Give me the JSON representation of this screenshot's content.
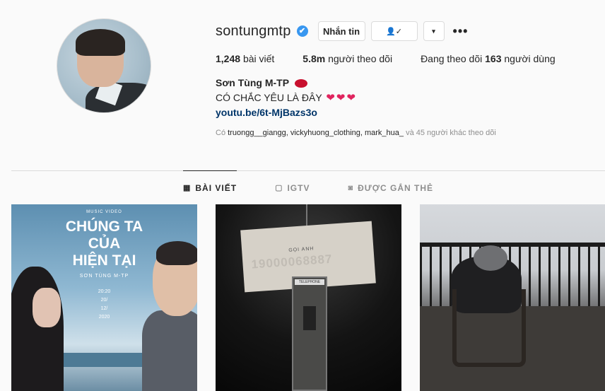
{
  "profile": {
    "username": "sontungmtp",
    "verified_icon": "✔",
    "buttons": {
      "message": "Nhắn tin",
      "follow_icon": "👤✓",
      "dropdown": "▾",
      "more": "•••"
    },
    "stats": {
      "posts_count": "1,248",
      "posts_label": "bài viết",
      "followers_count": "5.8m",
      "followers_label": "người theo dõi",
      "following_prefix": "Đang theo dõi",
      "following_count": "163",
      "following_suffix": "người dùng"
    },
    "bio": {
      "name": "Sơn Tùng M-TP",
      "line": "CÓ CHẮC YÊU LÀ ĐÂY",
      "link": "youtu.be/6t-MjBazs3o"
    },
    "followed_by": {
      "prefix": "Có",
      "names": "truongg__giangg, vickyhuong_clothing, mark_hua_",
      "suffix": "và 45 người khác theo dõi"
    }
  },
  "tabs": [
    {
      "label": "BÀI VIẾT",
      "icon": "grid-icon",
      "active": true
    },
    {
      "label": "IGTV",
      "icon": "igtv-icon",
      "active": false
    },
    {
      "label": "ĐƯỢC GẮN THẺ",
      "icon": "tag-icon",
      "active": false
    }
  ],
  "posts": [
    {
      "caption_small": "MUSIC VIDEO",
      "title_line1": "CHÚNG TA",
      "title_line2": "CỦA",
      "title_line3": "HIỆN TẠI",
      "artist": "SƠN TÙNG M-TP",
      "date_l1": "20:20",
      "date_l2": "20/",
      "date_l3": "12/",
      "date_l4": "2020"
    },
    {
      "sign_small": "GỌI ANH",
      "sign_number": "19000068887",
      "booth_label": "TELEPHONE"
    },
    {}
  ],
  "colors": {
    "verified": "#3897f0",
    "link": "#003569",
    "border": "#dbdbdb",
    "muted": "#8e8e8e"
  }
}
